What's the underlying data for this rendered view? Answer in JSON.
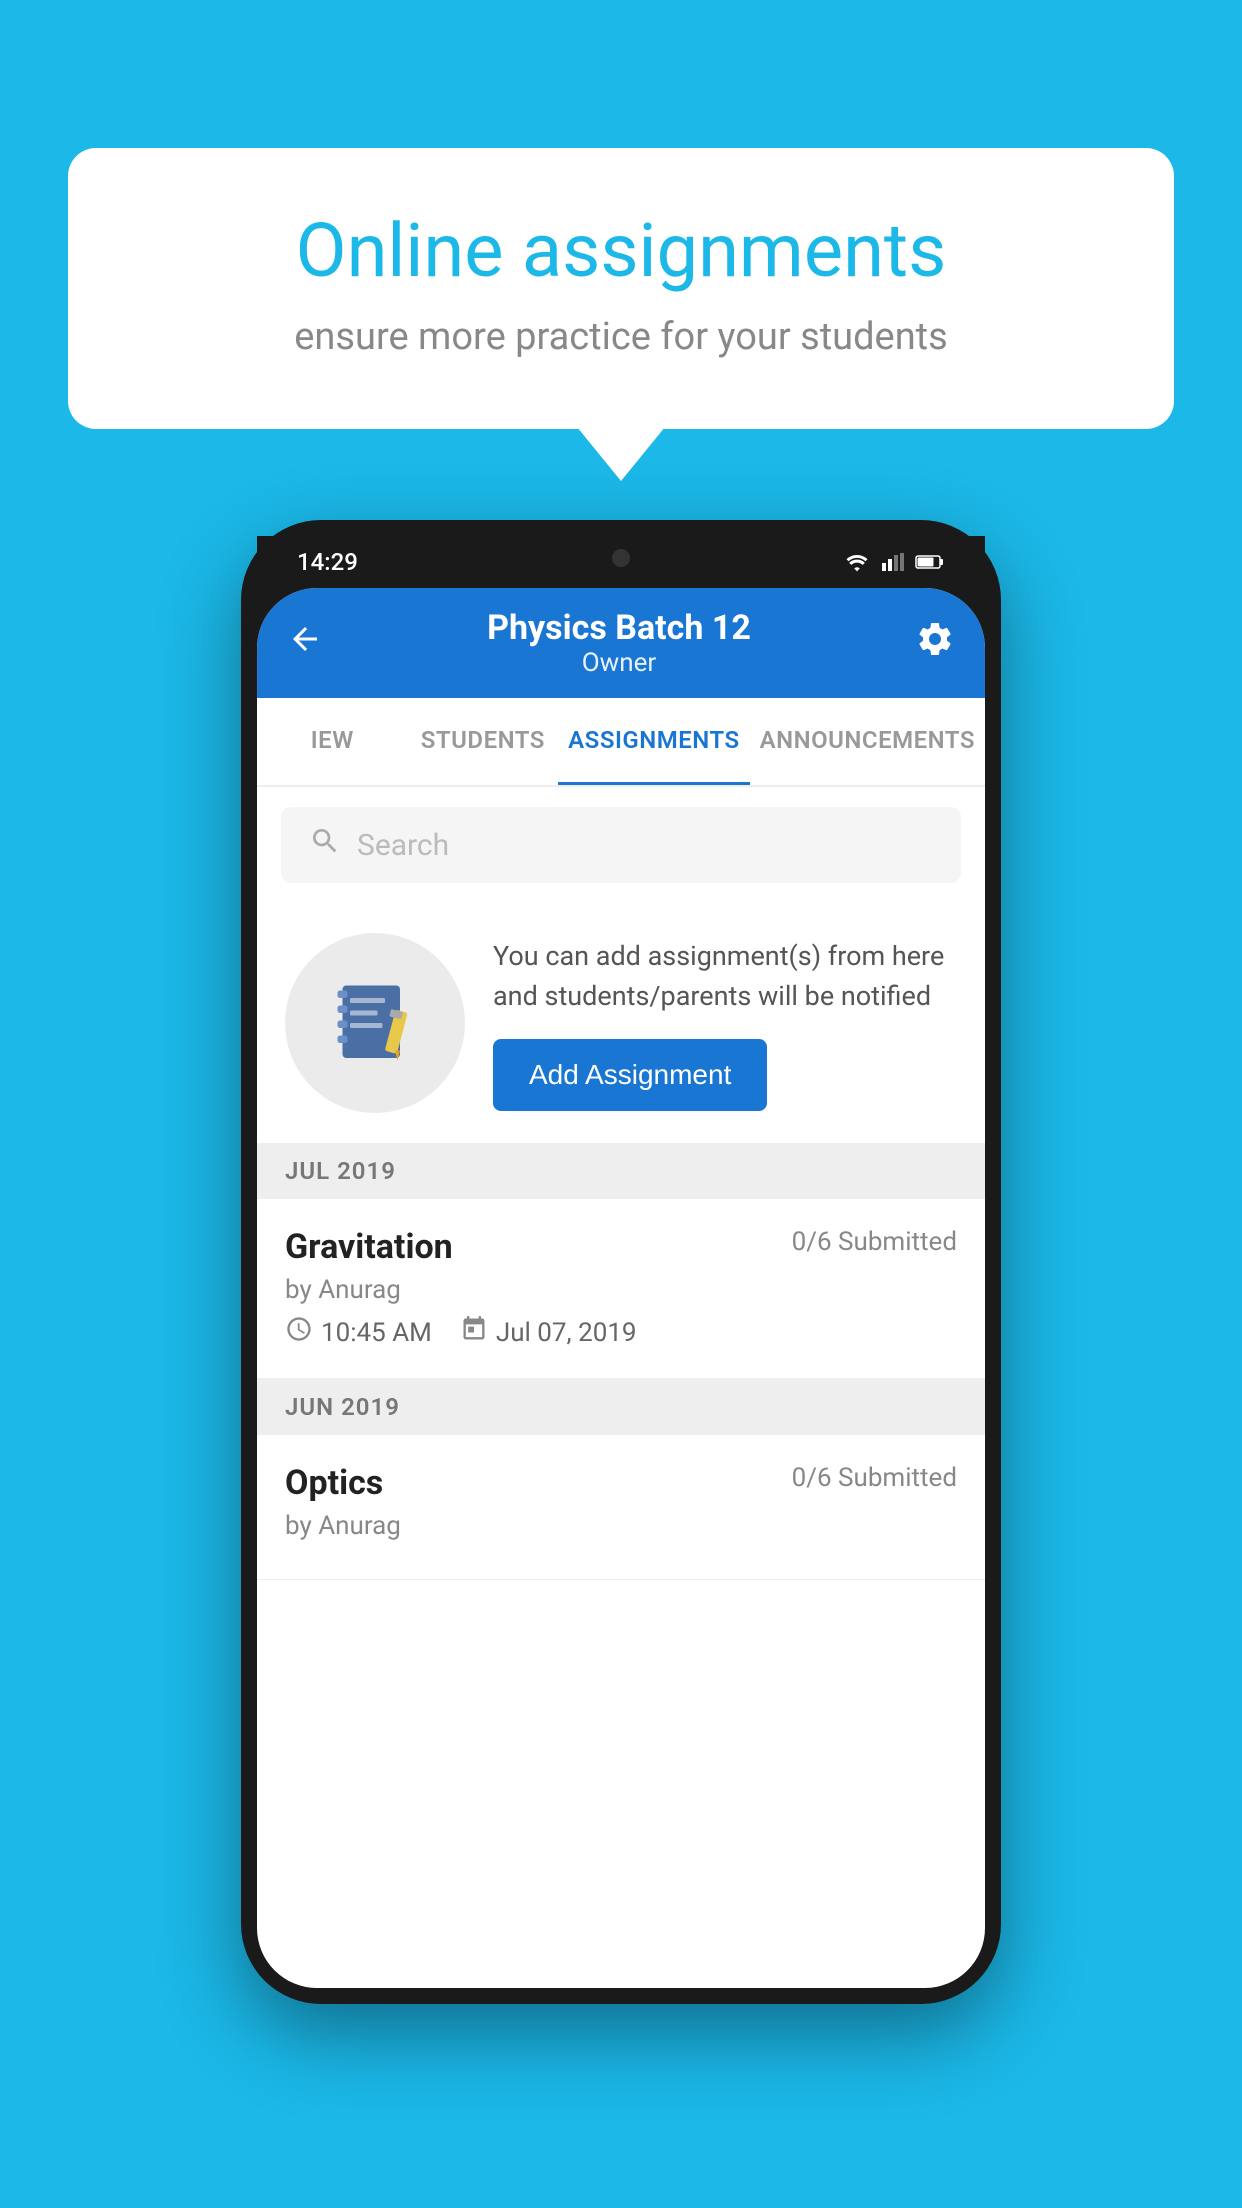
{
  "background": {
    "color": "#1bb8e8"
  },
  "speech_bubble": {
    "title": "Online assignments",
    "subtitle": "ensure more practice for your students"
  },
  "phone": {
    "status_bar": {
      "time": "14:29"
    },
    "header": {
      "title": "Physics Batch 12",
      "subtitle": "Owner"
    },
    "tabs": [
      {
        "label": "IEW",
        "active": false
      },
      {
        "label": "STUDENTS",
        "active": false
      },
      {
        "label": "ASSIGNMENTS",
        "active": true
      },
      {
        "label": "ANNOUNCEMENTS",
        "active": false
      }
    ],
    "search": {
      "placeholder": "Search"
    },
    "promo": {
      "text": "You can add assignment(s) from here and students/parents will be notified",
      "button_label": "Add Assignment"
    },
    "sections": [
      {
        "month": "JUL 2019",
        "assignments": [
          {
            "name": "Gravitation",
            "submitted": "0/6 Submitted",
            "by": "by Anurag",
            "time": "10:45 AM",
            "date": "Jul 07, 2019"
          }
        ]
      },
      {
        "month": "JUN 2019",
        "assignments": [
          {
            "name": "Optics",
            "submitted": "0/6 Submitted",
            "by": "by Anurag",
            "time": "",
            "date": ""
          }
        ]
      }
    ]
  }
}
